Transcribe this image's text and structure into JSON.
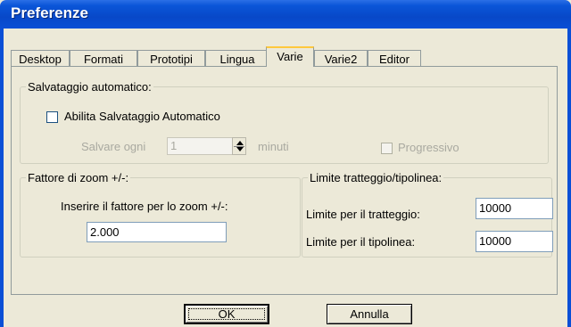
{
  "window": {
    "title": "Preferenze"
  },
  "tabs": [
    {
      "label": "Desktop"
    },
    {
      "label": "Formati"
    },
    {
      "label": "Prototipi"
    },
    {
      "label": "Lingua"
    },
    {
      "label": "Varie"
    },
    {
      "label": "Varie2"
    },
    {
      "label": "Editor"
    }
  ],
  "autosave": {
    "legend": "Salvataggio automatico:",
    "enable_label": "Abilita Salvataggio Automatico",
    "enable_checked": false,
    "interval_label": "Salvare ogni",
    "interval_value": "1",
    "interval_unit": "minuti",
    "progressive_label": "Progressivo",
    "progressive_checked": false
  },
  "zoom": {
    "legend": "Fattore di zoom +/-:",
    "prompt": "Inserire il fattore per lo zoom +/-:",
    "value": "2.000"
  },
  "limits": {
    "legend": "Limite tratteggio/tipolinea:",
    "hatch_label": "Limite per il tratteggio:",
    "hatch_value": "10000",
    "linetype_label": "Limite per il tipolinea:",
    "linetype_value": "10000"
  },
  "buttons": {
    "ok": "OK",
    "cancel": "Annulla"
  }
}
